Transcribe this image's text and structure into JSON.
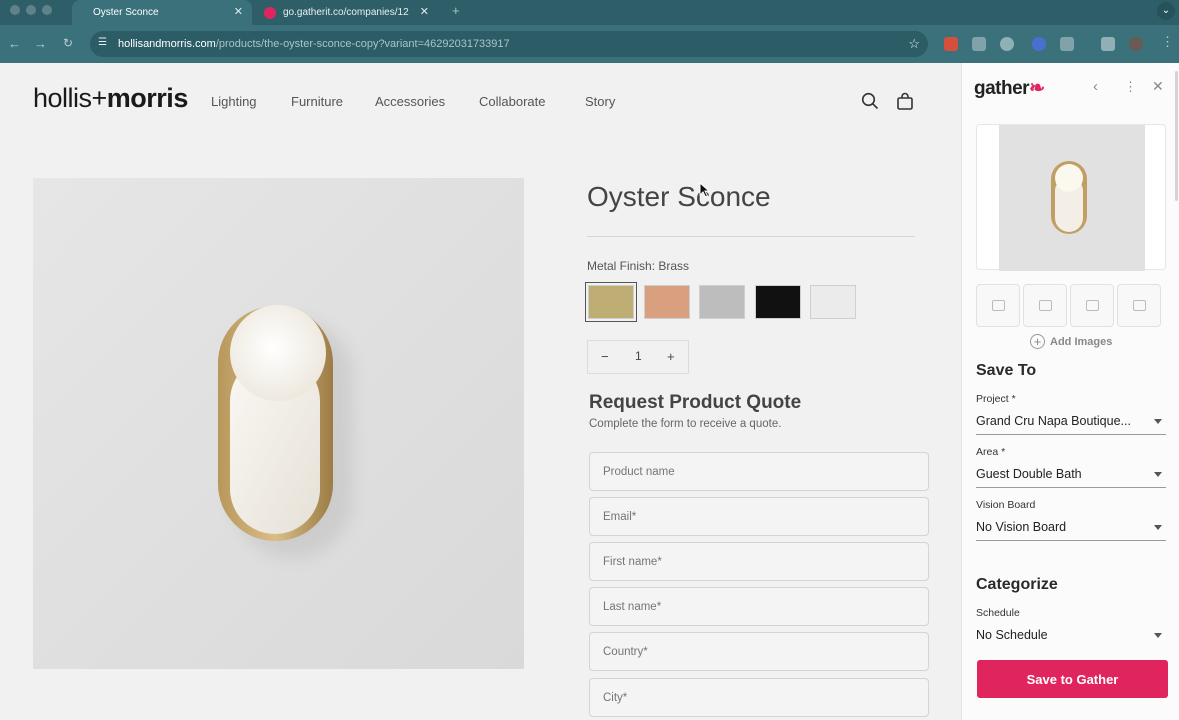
{
  "browser": {
    "tabs": [
      {
        "title": "Oyster Sconce",
        "active": true
      },
      {
        "title": "go.gatherit.co/companies/12",
        "active": false
      }
    ],
    "new_tab": "+",
    "tab_menu": "⌄",
    "url_domain": "hollisandmorris.com",
    "url_path": "/products/the-oyster-sconce-copy?variant=46292031733917"
  },
  "store": {
    "logo_light": "hollis+",
    "logo_bold": "morris",
    "nav": [
      "Lighting",
      "Furniture",
      "Accessories",
      "Collaborate",
      "Story"
    ],
    "product_name": "Oyster Sconce",
    "finish_label": "Metal Finish: Brass",
    "swatches": [
      {
        "name": "Brass",
        "color": "#bfae74",
        "selected": true
      },
      {
        "name": "Copper",
        "color": "#d9a07f",
        "selected": false
      },
      {
        "name": "Nickel",
        "color": "#bdbdbd",
        "selected": false
      },
      {
        "name": "Black",
        "color": "#111111",
        "selected": false
      },
      {
        "name": "White",
        "color": "#ebebeb",
        "selected": false
      }
    ],
    "quantity": {
      "minus": "−",
      "value": "1",
      "plus": "+"
    },
    "quote_title": "Request Product Quote",
    "quote_subtitle": "Complete the form to receive a quote.",
    "fields": [
      {
        "placeholder": "Product name"
      },
      {
        "placeholder": "Email*"
      },
      {
        "placeholder": "First name*"
      },
      {
        "placeholder": "Last name*"
      },
      {
        "placeholder": "Country*"
      },
      {
        "placeholder": "City*"
      }
    ]
  },
  "panel": {
    "logo": "gather",
    "add_images": "Add Images",
    "save_to": "Save To",
    "project_label": "Project *",
    "project_value": "Grand Cru Napa Boutique...",
    "area_label": "Area *",
    "area_value": "Guest Double Bath",
    "vision_label": "Vision Board",
    "vision_value": "No Vision Board",
    "categorize": "Categorize",
    "schedule_label": "Schedule",
    "schedule_value": "No Schedule",
    "save_button": "Save to Gather",
    "accent": "#e0245e"
  }
}
